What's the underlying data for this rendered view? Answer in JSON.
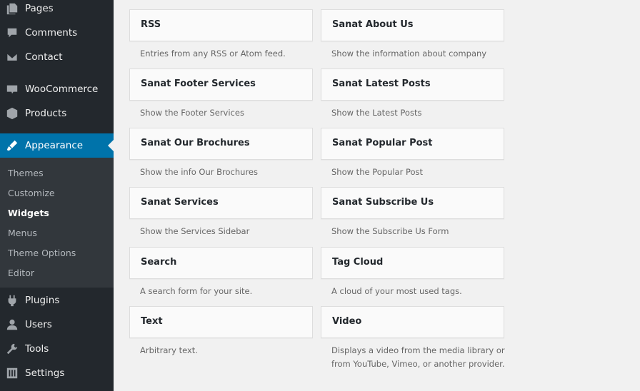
{
  "sidebar": {
    "items": [
      {
        "label": "Pages",
        "icon": "pages-icon"
      },
      {
        "label": "Comments",
        "icon": "comments-icon"
      },
      {
        "label": "Contact",
        "icon": "contact-icon"
      },
      {
        "label": "WooCommerce",
        "icon": "woocommerce-icon"
      },
      {
        "label": "Products",
        "icon": "products-icon"
      },
      {
        "label": "Appearance",
        "icon": "appearance-icon",
        "active": true
      },
      {
        "label": "Plugins",
        "icon": "plugins-icon"
      },
      {
        "label": "Users",
        "icon": "users-icon"
      },
      {
        "label": "Tools",
        "icon": "tools-icon"
      },
      {
        "label": "Settings",
        "icon": "settings-icon"
      }
    ],
    "submenu": [
      {
        "label": "Themes"
      },
      {
        "label": "Customize"
      },
      {
        "label": "Widgets",
        "current": true
      },
      {
        "label": "Menus"
      },
      {
        "label": "Theme Options"
      },
      {
        "label": "Editor"
      }
    ],
    "colors": {
      "background": "#23282d",
      "submenu_background": "#32373c",
      "active": "#0073aa"
    }
  },
  "widgets": [
    {
      "title": "RSS",
      "description": "Entries from any RSS or Atom feed."
    },
    {
      "title": "Sanat About Us",
      "description": "Show the information about company"
    },
    {
      "title": "Sanat Footer Services",
      "description": "Show the Footer Services"
    },
    {
      "title": "Sanat Latest Posts",
      "description": "Show the Latest Posts"
    },
    {
      "title": "Sanat Our Brochures",
      "description": "Show the info Our Brochures"
    },
    {
      "title": "Sanat Popular Post",
      "description": "Show the Popular Post"
    },
    {
      "title": "Sanat Services",
      "description": "Show the Services Sidebar"
    },
    {
      "title": "Sanat Subscribe Us",
      "description": "Show the Subscribe Us Form"
    },
    {
      "title": "Search",
      "description": "A search form for your site."
    },
    {
      "title": "Tag Cloud",
      "description": "A cloud of your most used tags."
    },
    {
      "title": "Text",
      "description": "Arbitrary text."
    },
    {
      "title": "Video",
      "description": "Displays a video from the media library or from YouTube, Vimeo, or another provider."
    }
  ]
}
